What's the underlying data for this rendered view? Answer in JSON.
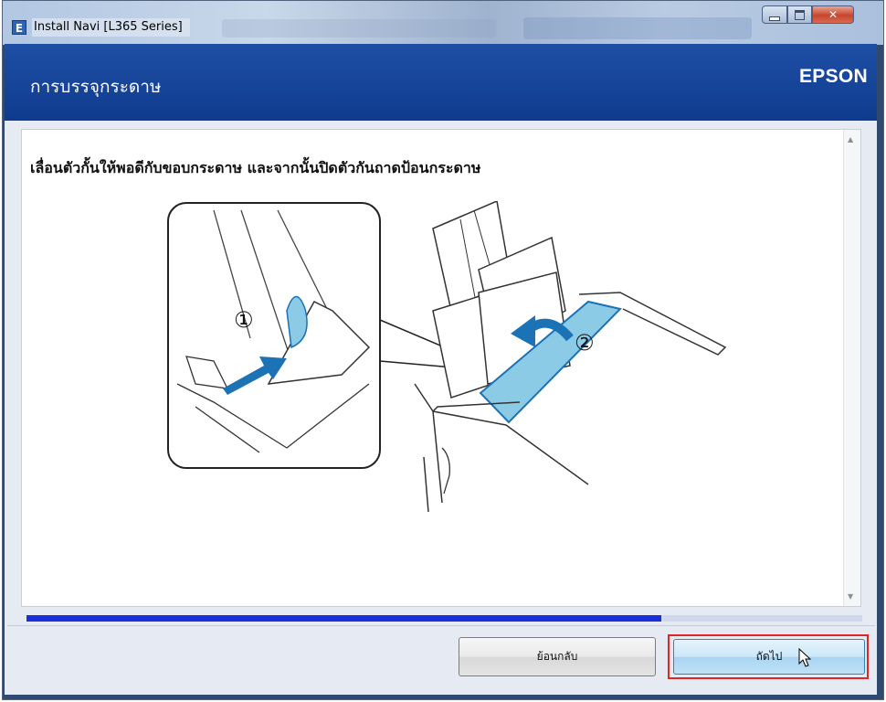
{
  "window": {
    "title": "Install Navi [L365 Series]"
  },
  "header": {
    "title": "การบรรจุกระดาษ",
    "brand": "EPSON"
  },
  "content": {
    "instruction": "เลื่อนตัวกั้นให้พอดีกับขอบกระดาษ และจากนั้นปิดตัวกันถาดป้อนกระดาษ",
    "step_labels": [
      "①",
      "②"
    ]
  },
  "progress": {
    "fraction": 0.76
  },
  "buttons": {
    "back": "ย้อนกลับ",
    "next": "ถัดไป"
  },
  "colors": {
    "header_blue": "#1a4a9e",
    "progress_blue": "#1a2fd9",
    "highlight_red": "#e02525",
    "guide_blue": "#8ccbe6",
    "arrow_blue": "#1b72b5"
  }
}
